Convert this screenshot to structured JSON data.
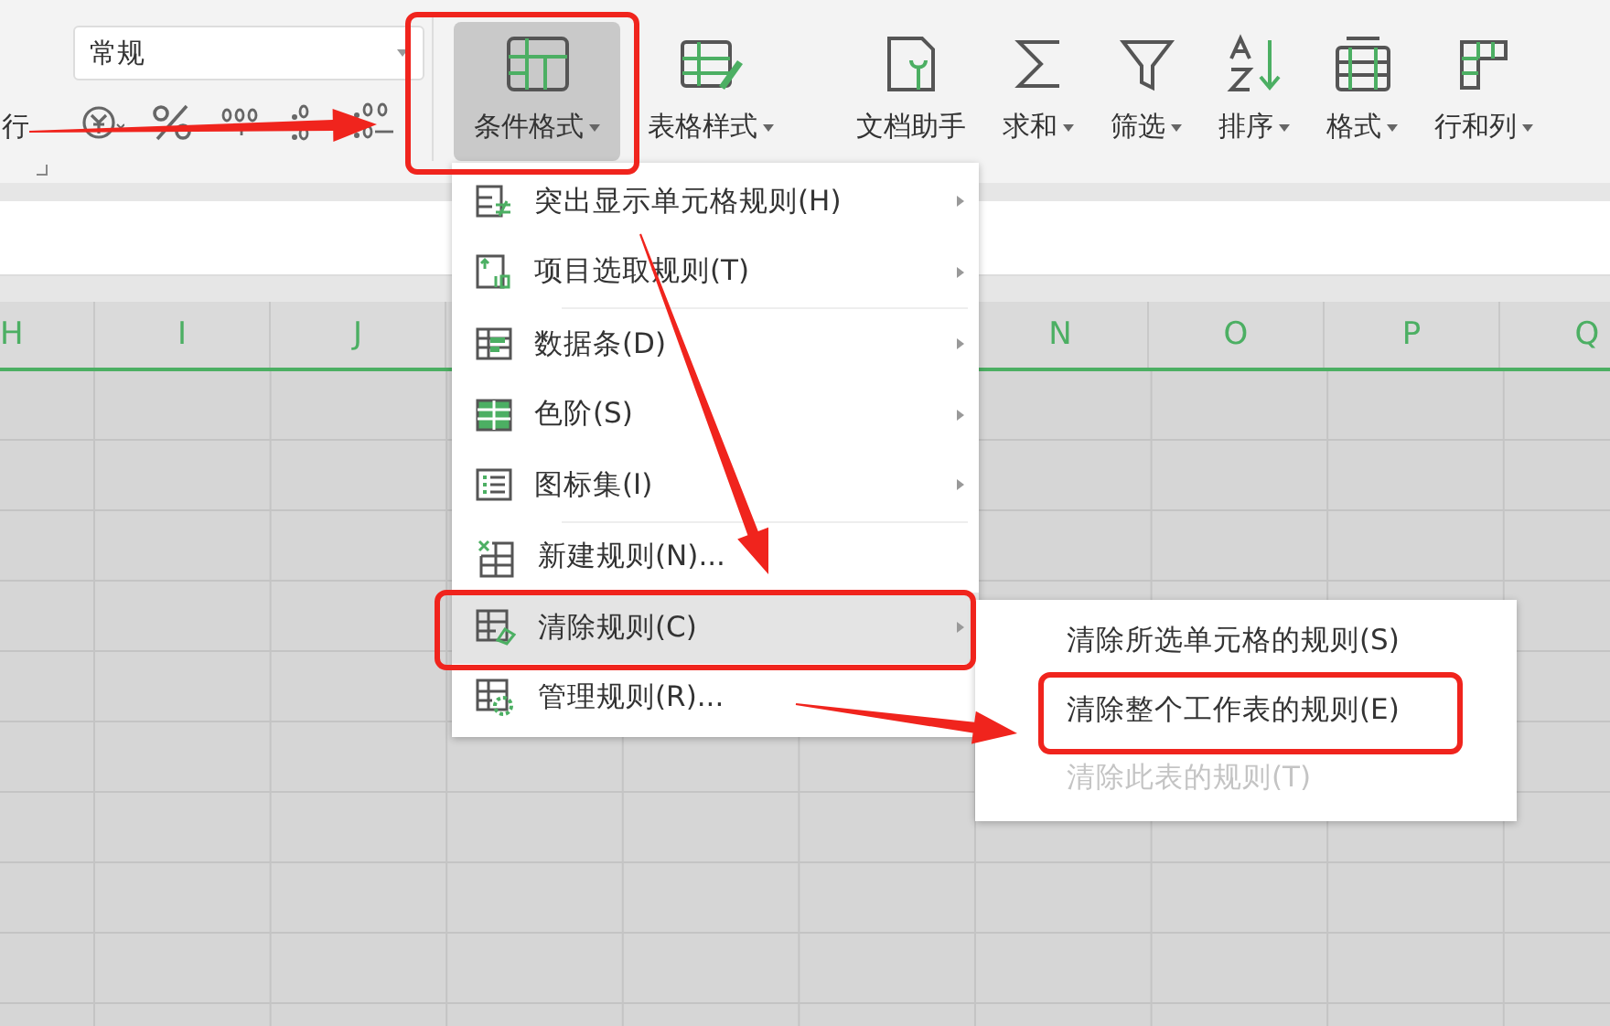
{
  "ribbon": {
    "cut_label": "行",
    "number_format": {
      "value": "常规"
    },
    "buttons": [
      {
        "label": "条件格式",
        "dropdown": true,
        "selected": true
      },
      {
        "label": "表格样式",
        "dropdown": true,
        "selected": false
      },
      {
        "label": "文档助手",
        "dropdown": false,
        "selected": false
      },
      {
        "label": "求和",
        "dropdown": true,
        "selected": false
      },
      {
        "label": "筛选",
        "dropdown": true,
        "selected": false
      },
      {
        "label": "排序",
        "dropdown": true,
        "selected": false
      },
      {
        "label": "格式",
        "dropdown": true,
        "selected": false
      },
      {
        "label": "行和列",
        "dropdown": true,
        "selected": false
      }
    ]
  },
  "sheet": {
    "columns": [
      "H",
      "I",
      "J",
      "N",
      "O",
      "P",
      "Q"
    ]
  },
  "menu": {
    "groups": [
      [
        {
          "label": "突出显示单元格规则(H)",
          "submenu": true,
          "selected": false
        },
        {
          "label": "项目选取规则(T)",
          "submenu": true,
          "selected": false
        }
      ],
      [
        {
          "label": "数据条(D)",
          "submenu": true,
          "selected": false
        },
        {
          "label": "色阶(S)",
          "submenu": true,
          "selected": false
        },
        {
          "label": "图标集(I)",
          "submenu": true,
          "selected": false
        }
      ],
      [
        {
          "label": "新建规则(N)...",
          "submenu": false,
          "selected": false
        },
        {
          "label": "清除规则(C)",
          "submenu": true,
          "selected": true
        },
        {
          "label": "管理规则(R)...",
          "submenu": false,
          "selected": false
        }
      ]
    ]
  },
  "submenu": {
    "items": [
      {
        "label": "清除所选单元格的规则(S)",
        "disabled": false
      },
      {
        "label": "清除整个工作表的规则(E)",
        "disabled": false
      },
      {
        "label": "清除此表的规则(T)",
        "disabled": true
      }
    ]
  }
}
